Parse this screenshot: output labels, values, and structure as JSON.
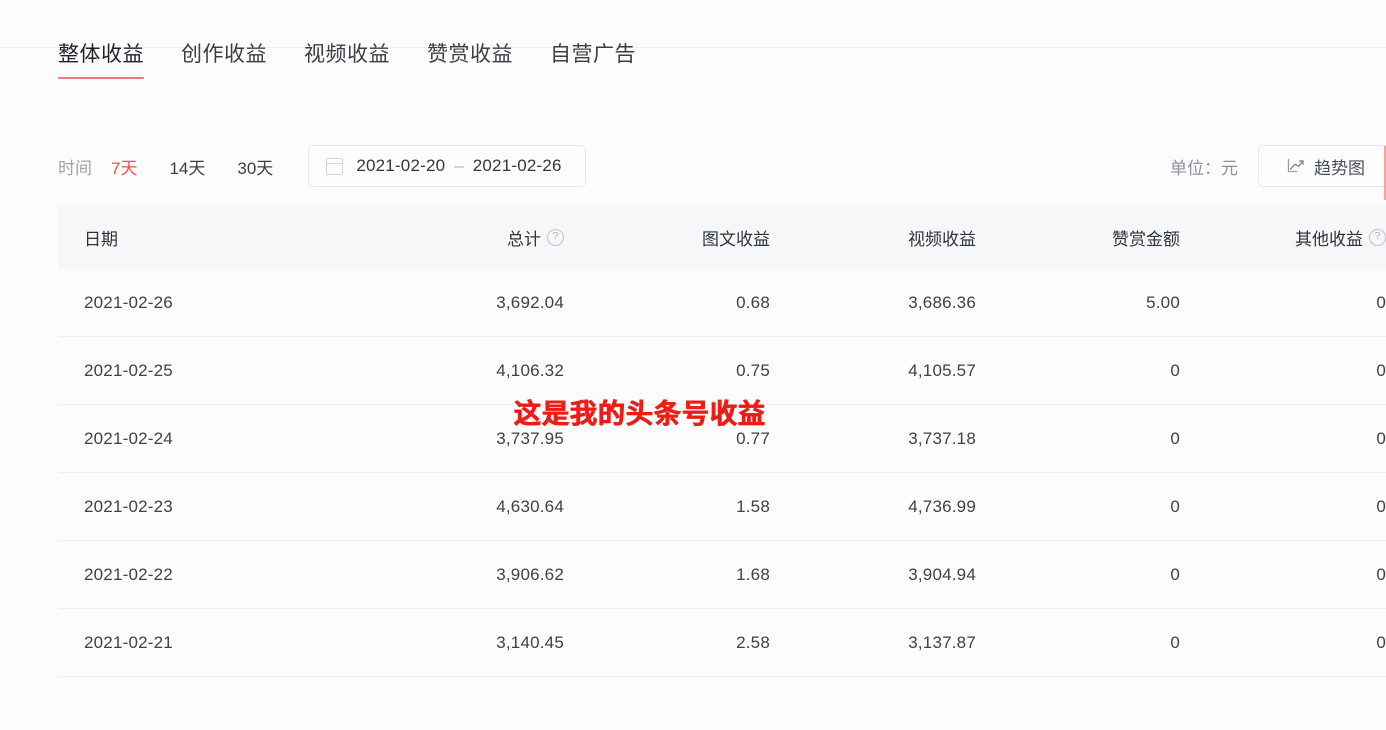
{
  "theme": {
    "accent": "#f0514f",
    "header_bg": "#f6f7f9",
    "page_bg": "#fcfcfd",
    "row_divider": "#eceef1",
    "watermark_color": "#ec1c17"
  },
  "tabs": [
    {
      "label": "整体收益",
      "active": true
    },
    {
      "label": "创作收益",
      "active": false
    },
    {
      "label": "视频收益",
      "active": false
    },
    {
      "label": "赞赏收益",
      "active": false
    },
    {
      "label": "自营广告",
      "active": false
    }
  ],
  "filters": {
    "time_label": "时间",
    "ranges": [
      {
        "label": "7天",
        "selected": true
      },
      {
        "label": "14天",
        "selected": false
      },
      {
        "label": "30天",
        "selected": false
      }
    ],
    "date_picker": {
      "icon": "calendar-icon",
      "start": "2021-02-20",
      "separator": "–",
      "end": "2021-02-26"
    },
    "unit_text": "单位：元",
    "trend_button": {
      "label": "趋势图",
      "icon": "line-chart-icon"
    }
  },
  "table": {
    "columns": [
      {
        "key": "date",
        "label": "日期",
        "help": false,
        "align": "left"
      },
      {
        "key": "total",
        "label": "总计",
        "help": true,
        "align": "right"
      },
      {
        "key": "image",
        "label": "图文收益",
        "help": false,
        "align": "right"
      },
      {
        "key": "video",
        "label": "视频收益",
        "help": false,
        "align": "right"
      },
      {
        "key": "tip",
        "label": "赞赏金额",
        "help": false,
        "align": "right"
      },
      {
        "key": "other",
        "label": "其他收益",
        "help": true,
        "align": "right"
      }
    ],
    "rows": [
      {
        "date": "2021-02-26",
        "total": "3,692.04",
        "image": "0.68",
        "video": "3,686.36",
        "tip": "5.00",
        "other": "0"
      },
      {
        "date": "2021-02-25",
        "total": "4,106.32",
        "image": "0.75",
        "video": "4,105.57",
        "tip": "0",
        "other": "0"
      },
      {
        "date": "2021-02-24",
        "total": "3,737.95",
        "image": "0.77",
        "video": "3,737.18",
        "tip": "0",
        "other": "0"
      },
      {
        "date": "2021-02-23",
        "total": "4,630.64",
        "image": "1.58",
        "video": "4,736.99",
        "tip": "0",
        "other": "0"
      },
      {
        "date": "2021-02-22",
        "total": "3,906.62",
        "image": "1.68",
        "video": "3,904.94",
        "tip": "0",
        "other": "0"
      },
      {
        "date": "2021-02-21",
        "total": "3,140.45",
        "image": "2.58",
        "video": "3,137.87",
        "tip": "0",
        "other": "0"
      }
    ]
  },
  "watermark": {
    "text": "这是我的头条号收益"
  }
}
